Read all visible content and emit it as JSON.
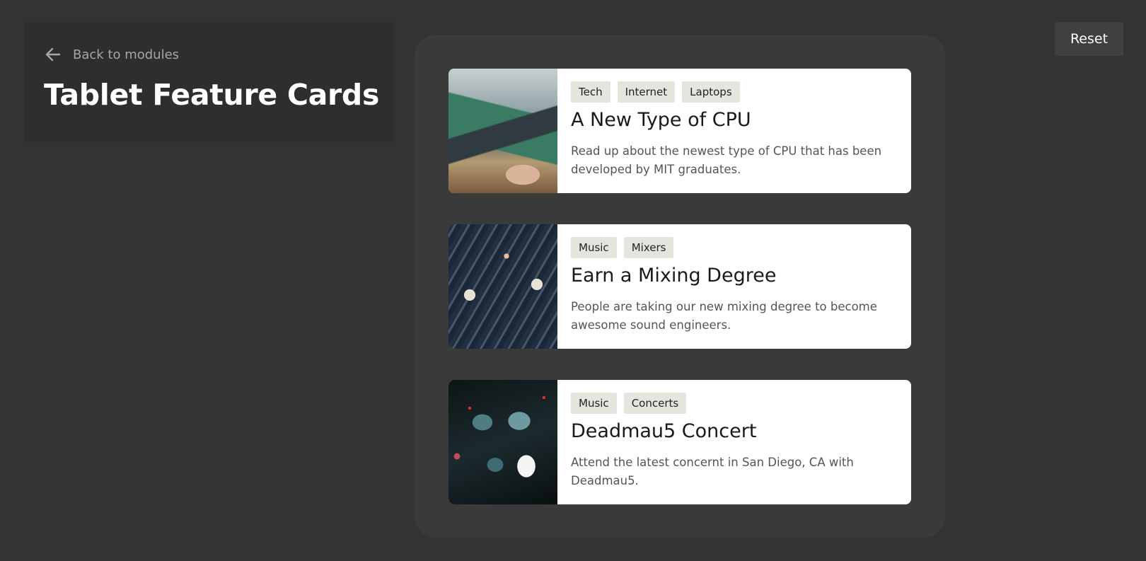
{
  "header": {
    "back_label": "Back to modules",
    "title": "Tablet Feature Cards"
  },
  "toolbar": {
    "reset_label": "Reset"
  },
  "cards": [
    {
      "tags": [
        "Tech",
        "Internet",
        "Laptops"
      ],
      "title": "A New Type of CPU",
      "description": "Read up about the newest type of CPU that has been developed by MIT graduates.",
      "image_icon": "laptop-photo"
    },
    {
      "tags": [
        "Music",
        "Mixers"
      ],
      "title": "Earn a Mixing Degree",
      "description": "People are taking our new mixing degree to become awesome sound engineers.",
      "image_icon": "mixing-console-photo"
    },
    {
      "tags": [
        "Music",
        "Concerts"
      ],
      "title": "Deadmau5 Concert",
      "description": "Attend the latest concernt in San Diego, CA with Deadmau5.",
      "image_icon": "concert-photo"
    }
  ],
  "colors": {
    "background": "#333333",
    "panel": "#2e2e2e",
    "cards_container": "#3a3a3a",
    "tag_bg": "#e6e5dd",
    "card_bg": "#ffffff"
  }
}
